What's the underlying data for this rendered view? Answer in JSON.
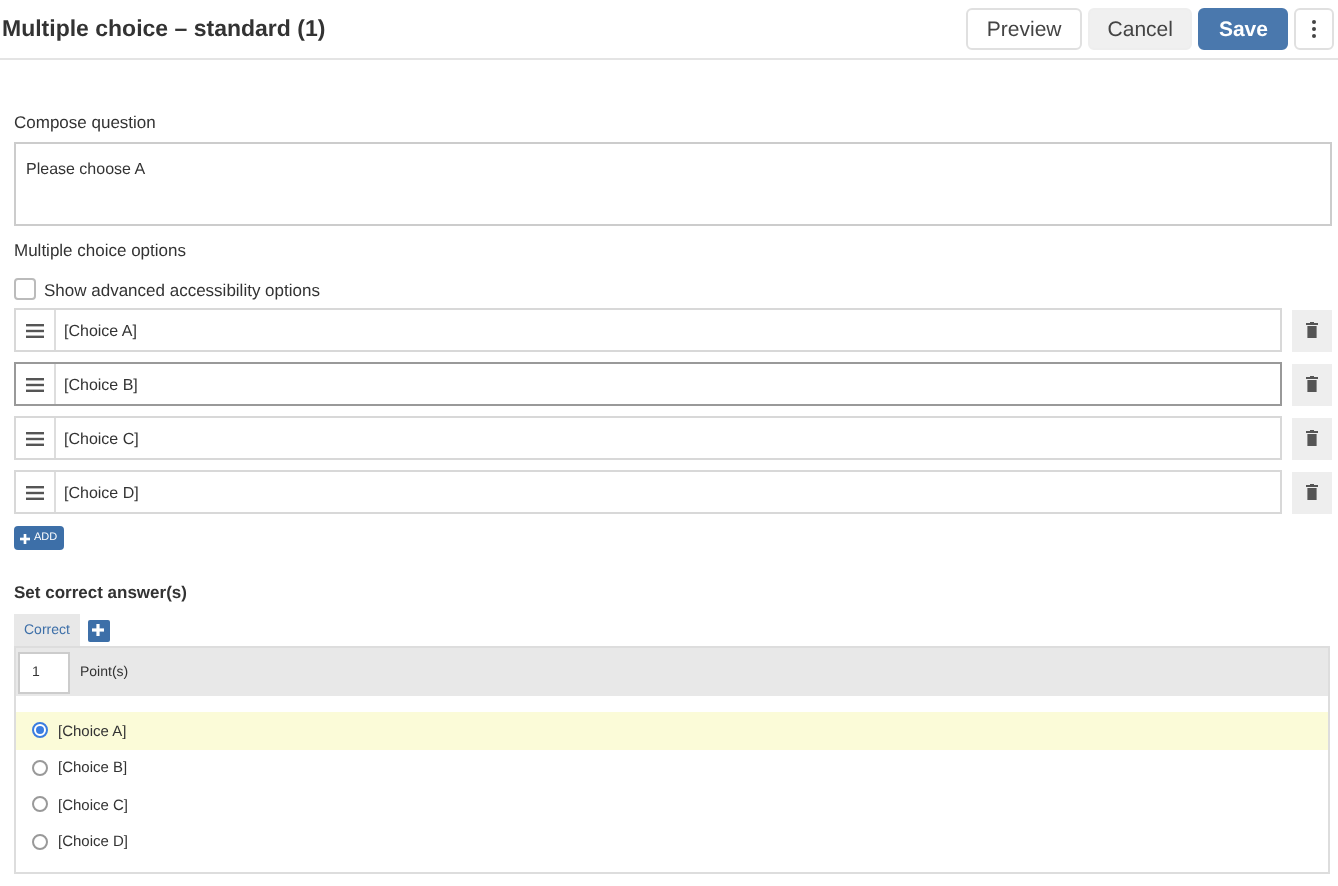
{
  "header": {
    "title": "Multiple choice – standard (1)",
    "buttons": [
      {
        "label": "Preview",
        "kind": "outline"
      },
      {
        "label": "Cancel",
        "kind": "plain"
      },
      {
        "label": "Save",
        "kind": "primary"
      }
    ]
  },
  "compose": {
    "label": "Compose question",
    "value": "Please choose A"
  },
  "options": {
    "label": "Multiple choice options",
    "accessibility": {
      "label": "Show advanced accessibility options",
      "checked": false
    },
    "choices": [
      {
        "value": "[Choice A]",
        "focused": false
      },
      {
        "value": "[Choice B]",
        "focused": true
      },
      {
        "value": "[Choice C]",
        "focused": false
      },
      {
        "value": "[Choice D]",
        "focused": false
      }
    ],
    "add_label": "ADD"
  },
  "answers": {
    "title": "Set correct answer(s)",
    "tabs": [
      {
        "label": "Correct",
        "selected": true
      }
    ],
    "points": {
      "value": "1",
      "label": "Point(s)"
    },
    "choices": [
      {
        "label": "[Choice A]",
        "selected": true
      },
      {
        "label": "[Choice B]",
        "selected": false
      },
      {
        "label": "[Choice C]",
        "selected": false
      },
      {
        "label": "[Choice D]",
        "selected": false
      }
    ]
  }
}
